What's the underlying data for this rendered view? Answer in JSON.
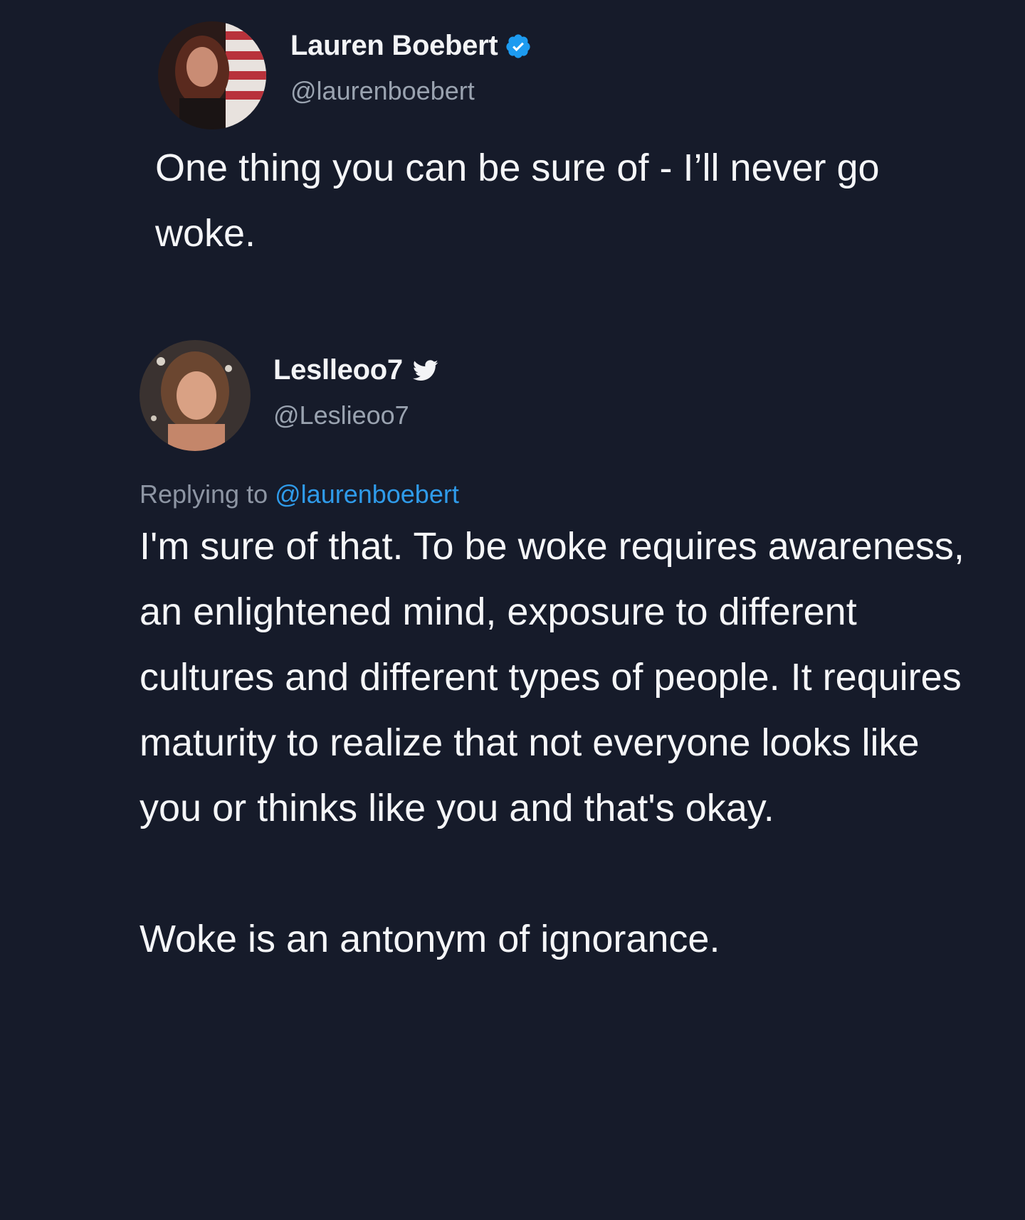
{
  "original_tweet": {
    "author_name": "Lauren Boebert",
    "author_handle": "@laurenboebert",
    "verified": true,
    "text": "One thing you can be sure of - I’ll never go woke."
  },
  "reply_tweet": {
    "author_name": "Leslleoo7",
    "author_handle": "@Leslieoo7",
    "replying_to_label": "Replying to",
    "replying_to_handle": "@laurenboebert",
    "text": "I'm sure of that. To be woke requires awareness, an enlightened mind, exposure to different cultures and different types of people. It requires maturity to realize that not everyone looks like you or thinks like you and that's okay.\n\nWoke is an antonym of ignorance."
  },
  "icons": {
    "verified": "verified-badge-icon",
    "bird": "twitter-bird-icon"
  },
  "colors": {
    "background": "#161b2a",
    "text": "#f5f6f8",
    "muted": "#9aa3b0",
    "accent": "#1d9bf0"
  }
}
